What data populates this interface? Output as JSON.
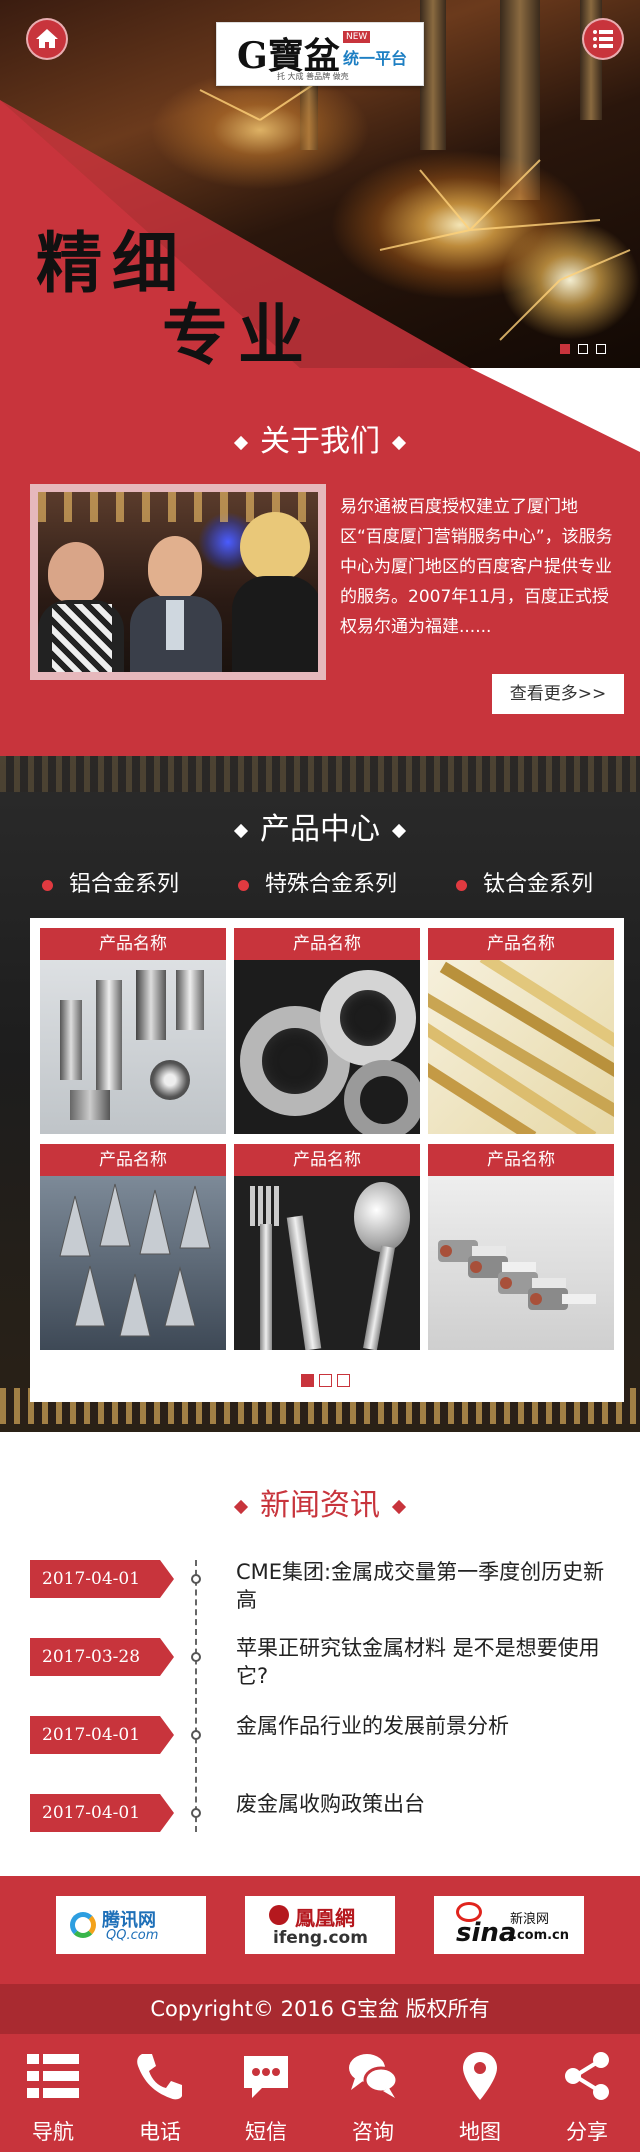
{
  "header": {
    "home_icon": "home-icon",
    "menu_icon": "list-icon",
    "logo": {
      "brand": "G寶盆",
      "badge": "NEW",
      "slogan": "统一平台",
      "tagline": "托 大成 善品牌 做壳"
    }
  },
  "hero": {
    "headline_1": "精细",
    "headline_2": "专业",
    "slides": 3,
    "active_slide": 1
  },
  "about": {
    "title": "关于我们",
    "text": "易尔通被百度授权建立了厦门地区“百度厦门营销服务中心”，该服务中心为厦门地区的百度客户提供专业的服务。2007年11月，百度正式授权易尔通为福建......",
    "more_label": "查看更多>>"
  },
  "products": {
    "title": "产品中心",
    "categories": [
      "铝合金系列",
      "特殊合金系列",
      "钛合金系列"
    ],
    "items": [
      {
        "label": "产品名称"
      },
      {
        "label": "产品名称"
      },
      {
        "label": "产品名称"
      },
      {
        "label": "产品名称"
      },
      {
        "label": "产品名称"
      },
      {
        "label": "产品名称"
      }
    ],
    "pages": 3,
    "active_page": 1
  },
  "news": {
    "title": "新闻资讯",
    "items": [
      {
        "date": "2017-04-01",
        "title": "CME集团:金属成交量第一季度创历史新高"
      },
      {
        "date": "2017-03-28",
        "title": "苹果正研究钛金属材料 是不是想要使用它?"
      },
      {
        "date": "2017-04-01",
        "title": "金属作品行业的发展前景分析"
      },
      {
        "date": "2017-04-01",
        "title": "废金属收购政策出台"
      }
    ]
  },
  "links": {
    "tencent": {
      "name": "腾讯网",
      "domain": "QQ.com"
    },
    "ifeng": {
      "name": "鳳凰網",
      "domain": "ifeng.com"
    },
    "sina": {
      "name": "sina",
      "suffix": "新浪网",
      "domain": ".com.cn"
    }
  },
  "footer": {
    "copyright": "Copyright© 2016  G宝盆 版权所有"
  },
  "bottom_nav": [
    {
      "label": "导航",
      "icon": "menu-icon"
    },
    {
      "label": "电话",
      "icon": "phone-icon"
    },
    {
      "label": "短信",
      "icon": "sms-icon"
    },
    {
      "label": "咨询",
      "icon": "chat-icon"
    },
    {
      "label": "地图",
      "icon": "map-pin-icon"
    },
    {
      "label": "分享",
      "icon": "share-icon"
    }
  ],
  "colors": {
    "primary_red": "#c8343c",
    "dark_red": "#a92a30"
  }
}
